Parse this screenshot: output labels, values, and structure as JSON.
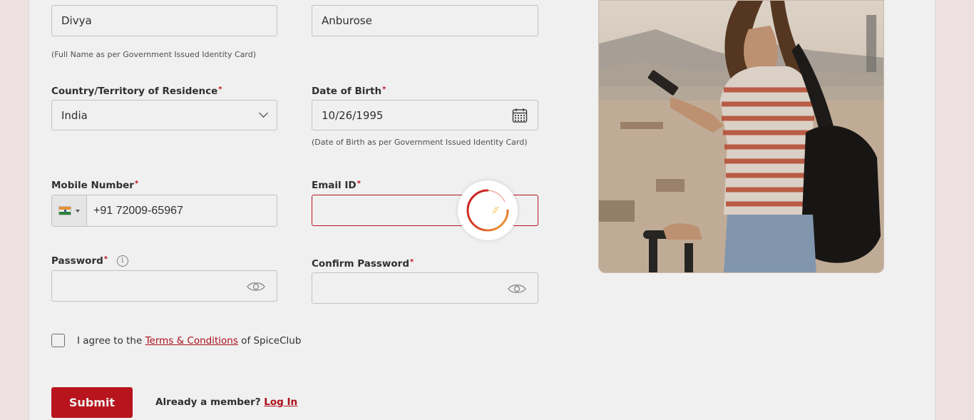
{
  "form": {
    "first_name": {
      "value": "Divya"
    },
    "last_name": {
      "value": "Anburose"
    },
    "name_hint": "(Full Name as per Government Issued Identity Card)",
    "country": {
      "label": "Country/Territory of Residence",
      "required_mark": "*",
      "value": "India"
    },
    "dob": {
      "label": "Date of Birth",
      "required_mark": "*",
      "value": "10/26/1995",
      "hint": "(Date of Birth as per Government Issued Identity Card)"
    },
    "mobile": {
      "label": "Mobile Number",
      "required_mark": "*",
      "value": "+91 72009-65967"
    },
    "email": {
      "label": "Email ID",
      "required_mark": "*",
      "value": ""
    },
    "password": {
      "label": "Password",
      "required_mark": "*",
      "info": "i",
      "value": ""
    },
    "confirm_password": {
      "label": "Confirm Password",
      "required_mark": "*",
      "value": ""
    },
    "agree": {
      "prefix": "I agree to the ",
      "link": "Terms & Conditions",
      "suffix": " of SpiceClub"
    },
    "submit_label": "Submit",
    "member_text": "Already a member? ",
    "login_link": "Log In"
  },
  "colors": {
    "accent": "#c4161f",
    "error_border": "#c4161f"
  },
  "icons": [
    "chevron-down-icon",
    "calendar-icon",
    "india-flag-icon",
    "info-icon",
    "eye-icon",
    "loading-spinner-icon"
  ]
}
